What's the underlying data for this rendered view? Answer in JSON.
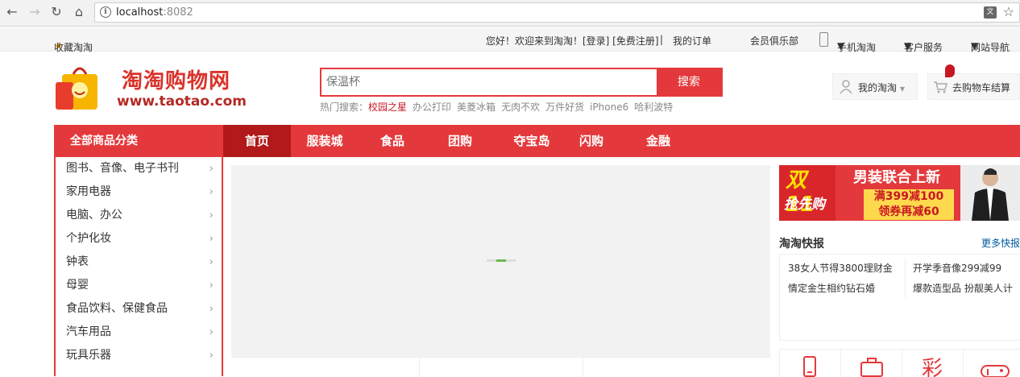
{
  "browser": {
    "url_host": "localhost",
    "url_port": ":8082"
  },
  "topbar": {
    "favorite": "收藏淘淘",
    "greeting": "您好！欢迎来到淘淘！[登录] [免费注册]",
    "orders": "我的订单",
    "club": "会员俱乐部",
    "mobile": "手机淘淘",
    "service": "客户服务",
    "sitemap": "网站导航"
  },
  "logo": {
    "cn": "淘淘购物网",
    "en": "www.taotao.com"
  },
  "search": {
    "placeholder": "保温杯",
    "button": "搜索",
    "hot_label": "热门搜索：",
    "hot_words": [
      "校园之星",
      "办公打印",
      "美菱冰箱",
      "无肉不欢",
      "万件好货",
      "iPhone6",
      "哈利波特"
    ]
  },
  "header": {
    "my_shop": "我的淘淘",
    "cart": "去购物车结算"
  },
  "nav": {
    "all_categories": "全部商品分类",
    "items": [
      "首页",
      "服装城",
      "食品",
      "团购",
      "夺宝岛",
      "闪购",
      "金融"
    ]
  },
  "categories": [
    "图书、音像、电子书刊",
    "家用电器",
    "电脑、办公",
    "个护化妆",
    "钟表",
    "母婴",
    "食品饮料、保健食品",
    "汽车用品",
    "玩具乐器"
  ],
  "banner": {
    "double11": "双11",
    "rush": "抢先购",
    "headline": "男装联合上新",
    "offer1": "满399减100",
    "offer2": "领券再减60"
  },
  "quick_news": {
    "title": "淘淘快报",
    "more": "更多快报",
    "items": [
      "38女人节得3800理财金",
      "开学季音像299减99",
      "情定金生相约钻石婚",
      "爆款造型品 扮靓美人计"
    ]
  },
  "service_icons": [
    "phone-recharge-icon",
    "travel-icon",
    "lottery-icon",
    "game-icon"
  ],
  "colors": {
    "brand_red": "#e4393c",
    "nav_active": "#b1191a",
    "banner_yellow": "#ffd94d"
  }
}
